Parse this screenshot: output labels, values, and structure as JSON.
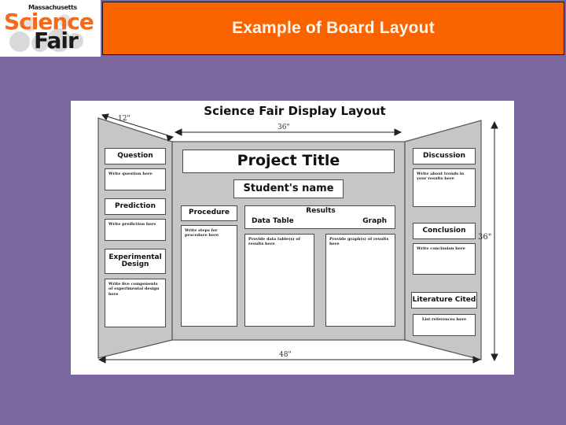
{
  "slide": {
    "background_color": "#7a679f"
  },
  "header": {
    "title": "Example of Board Layout",
    "title_color": "#fdf6ec",
    "band_color": "#fa6400",
    "logo": {
      "line1": "Massachusetts",
      "line2": "Science",
      "line3": "Fair",
      "science_color": "#f26a1b",
      "fair_color": "#1a1a1a"
    }
  },
  "diagram": {
    "title": "Science Fair Display Layout",
    "dimensions": {
      "wing_depth": "12\"",
      "center_width": "36\"",
      "board_height": "36\"",
      "total_width": "48\""
    },
    "left_panel": {
      "sections": [
        {
          "heading": "Question",
          "body": "Write question here"
        },
        {
          "heading": "Prediction",
          "body": "Write prediction here"
        },
        {
          "heading": "Experimental Design",
          "body": "Write five components of experimental design here"
        }
      ]
    },
    "center_panel": {
      "project_title": "Project Title",
      "student_name": "Student's name",
      "procedure": {
        "heading": "Procedure",
        "body": "Write steps for procedure here"
      },
      "results": {
        "heading": "Results",
        "left_label": "Data Table",
        "right_label": "Graph",
        "data_table_body": "Provide data table(s) of results here",
        "graph_body": "Provide graph(s) of results here"
      }
    },
    "right_panel": {
      "sections": [
        {
          "heading": "Discussion",
          "body": "Write about trends in your results here"
        },
        {
          "heading": "Conclusion",
          "body": "Write conclusion here"
        },
        {
          "heading": "Literature Cited",
          "body": "List references here"
        }
      ]
    }
  }
}
